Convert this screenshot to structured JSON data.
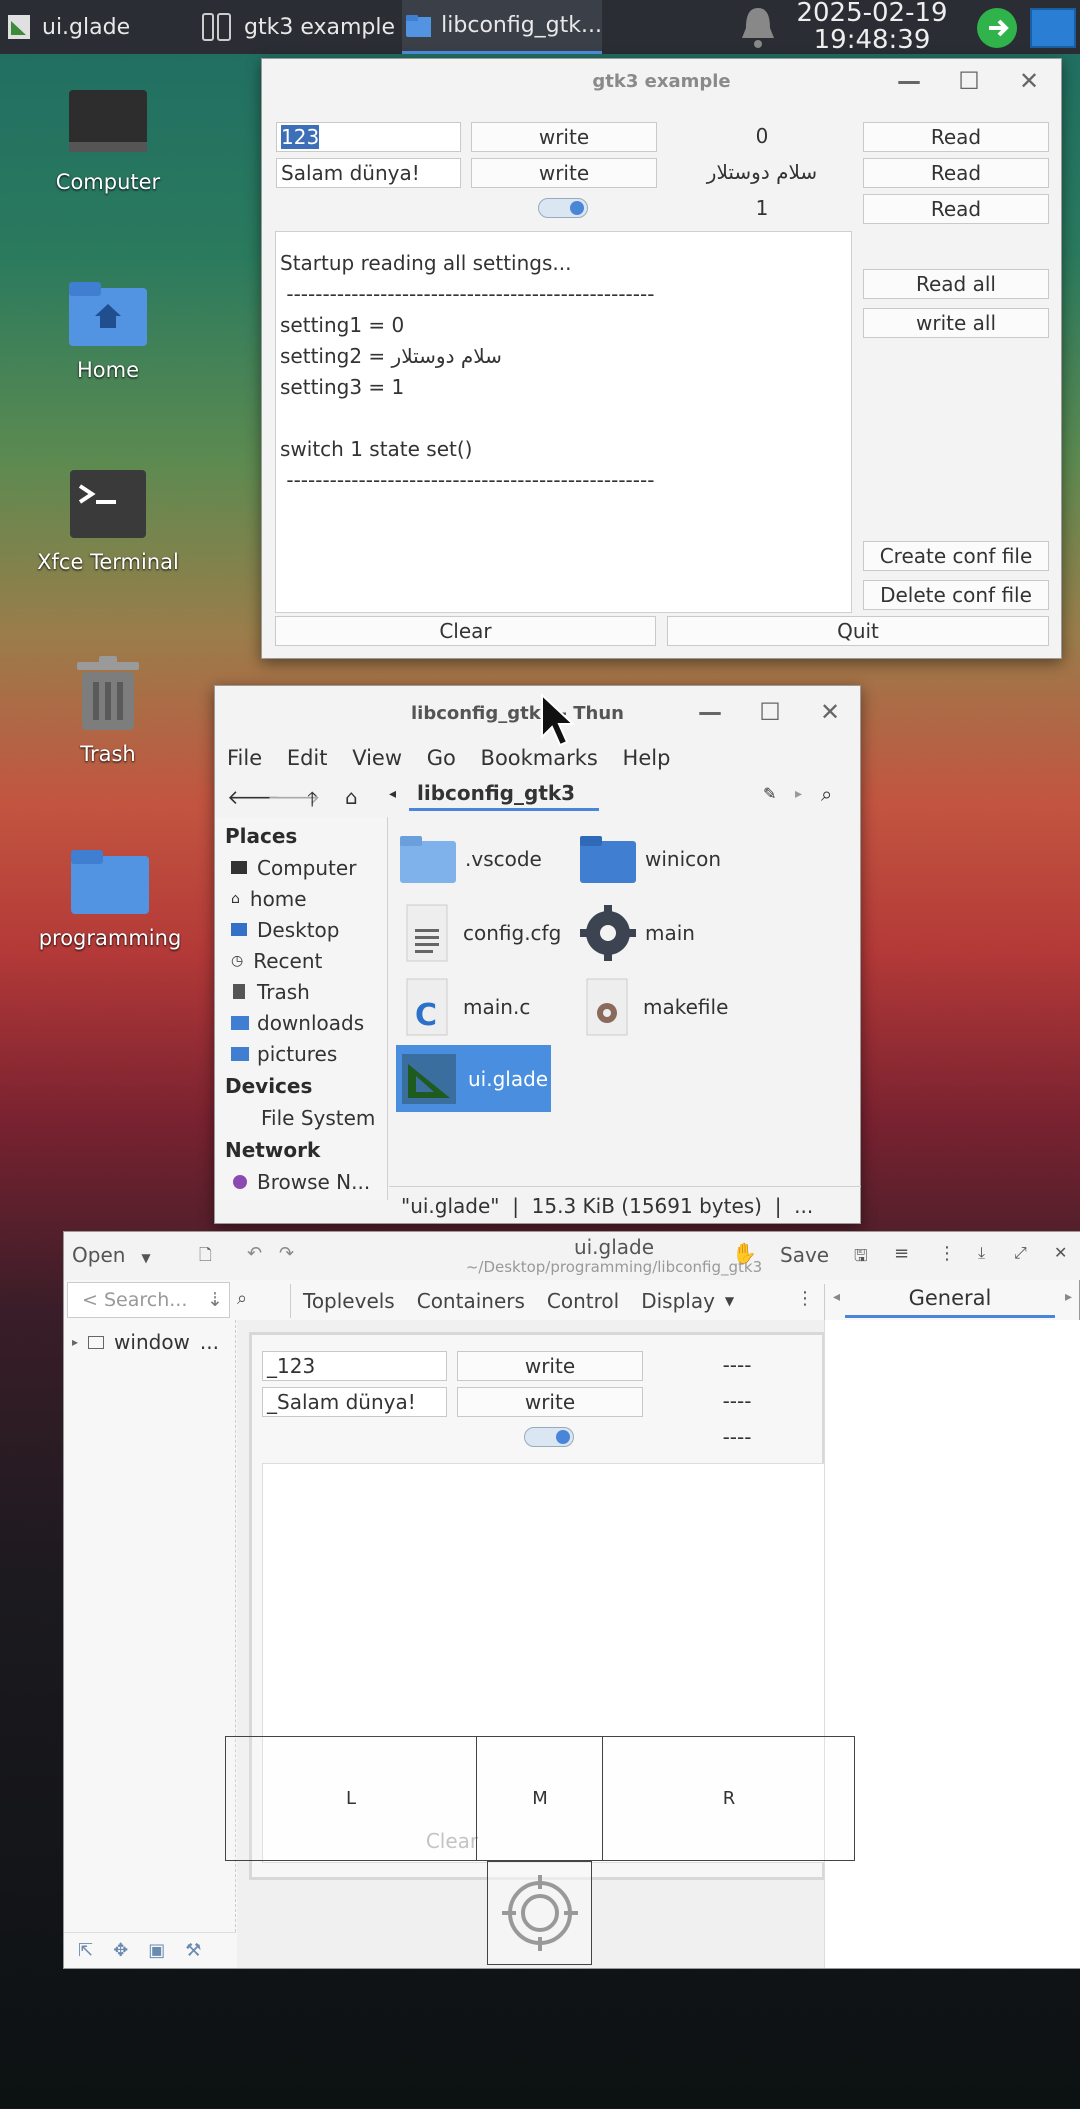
{
  "taskbar": {
    "tasks": [
      "ui.glade",
      "gtk3 example",
      "libconfig_gtk..."
    ],
    "date": "2025-02-19",
    "time": "19:48:39"
  },
  "desktop": {
    "icons": [
      "Computer",
      "Home",
      "Xfce Terminal",
      "Trash",
      "programming"
    ]
  },
  "gtk3": {
    "title": "gtk3 example",
    "row1": {
      "entry": "123",
      "button": "write",
      "value": "0",
      "read": "Read"
    },
    "row2": {
      "entry": "Salam dünya!",
      "button": "write",
      "value": "سلام دوستلار",
      "read": "Read"
    },
    "row3": {
      "value": "1",
      "read": "Read",
      "switch_on": true
    },
    "log": [
      "Startup reading all settings...",
      " ---------------------------------------------------",
      "setting1 = 0",
      "setting2 = سلام دوستلار",
      "setting3 = 1",
      "",
      "switch 1 state set()",
      " ---------------------------------------------------"
    ],
    "read_all": "Read all",
    "write_all": "write all",
    "create_conf": "Create conf file",
    "delete_conf": "Delete conf file",
    "clear": "Clear",
    "quit": "Quit"
  },
  "thunar": {
    "title": "libconfig_gtk3 - Thun",
    "menu": [
      "File",
      "Edit",
      "View",
      "Go",
      "Bookmarks",
      "Help"
    ],
    "location": "libconfig_gtk3",
    "places_header": "Places",
    "places": [
      "Computer",
      "home",
      "Desktop",
      "Recent",
      "Trash",
      "downloads",
      "pictures"
    ],
    "devices_header": "Devices",
    "devices": [
      "File System"
    ],
    "network_header": "Network",
    "network": [
      "Browse N..."
    ],
    "files": [
      ".vscode",
      "winicon",
      "config.cfg",
      "main",
      "main.c",
      "makefile",
      "ui.glade"
    ],
    "status": "\"ui.glade\"  |  15.3 KiB (15691 bytes)  |  ..."
  },
  "glade": {
    "title": "ui.glade",
    "subtitle": "~/Desktop/programming/libconfig_gtk3",
    "open": "Open",
    "save": "Save",
    "search_placeholder": "< Search...",
    "tabs": [
      "Toplevels",
      "Containers",
      "Control",
      "Display"
    ],
    "general_tab": "General",
    "tree_item": "window",
    "tree_item_more": "...",
    "preview": {
      "entry1": "_123",
      "entry2": "_Salam dünya!",
      "write": "write",
      "dash": "----",
      "clear": "Clear"
    },
    "lmr": [
      "L",
      "M",
      "R"
    ]
  }
}
